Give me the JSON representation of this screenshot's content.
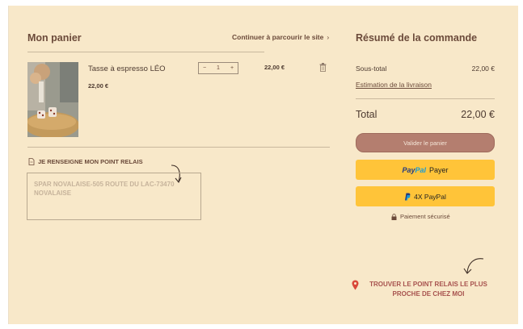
{
  "cart": {
    "title": "Mon panier",
    "continue_label": "Continuer à parcourir le site",
    "item": {
      "name": "Tasse à espresso LÉO",
      "unit_price": "22,00 €",
      "quantity": "1",
      "line_total": "22,00 €"
    },
    "relay": {
      "label": "JE RENSEIGNE MON POINT RELAIS",
      "address": "SPAR NOVALAISE-505 ROUTE DU LAC-73470 NOVALAISE"
    }
  },
  "summary": {
    "title": "Résumé de la commande",
    "subtotal_label": "Sous-total",
    "subtotal_value": "22,00 €",
    "shipping_link": "Estimation de la livraison",
    "total_label": "Total",
    "total_value": "22,00 €",
    "validate_label": "Valider le panier",
    "paypal_brand_1": "Pay",
    "paypal_brand_2": "Pal",
    "paypal_label": "Payer",
    "paypal4x_label": "4X PayPal",
    "secure_label": "Paiement sécurisé",
    "find_relay_label": "TROUVER LE POINT RELAIS LE PLUS PROCHE DE CHEZ MOI"
  },
  "colors": {
    "background": "#f8e8c9",
    "validate_button": "#b47e6f",
    "paypal_button": "#ffc439",
    "relay_cta": "#a7524e"
  },
  "icons": [
    "chevron-right-icon",
    "minus-icon",
    "plus-icon",
    "trash-icon",
    "document-icon",
    "arrow-icon",
    "paypal-logo-icon",
    "lock-icon",
    "location-pin-icon"
  ]
}
